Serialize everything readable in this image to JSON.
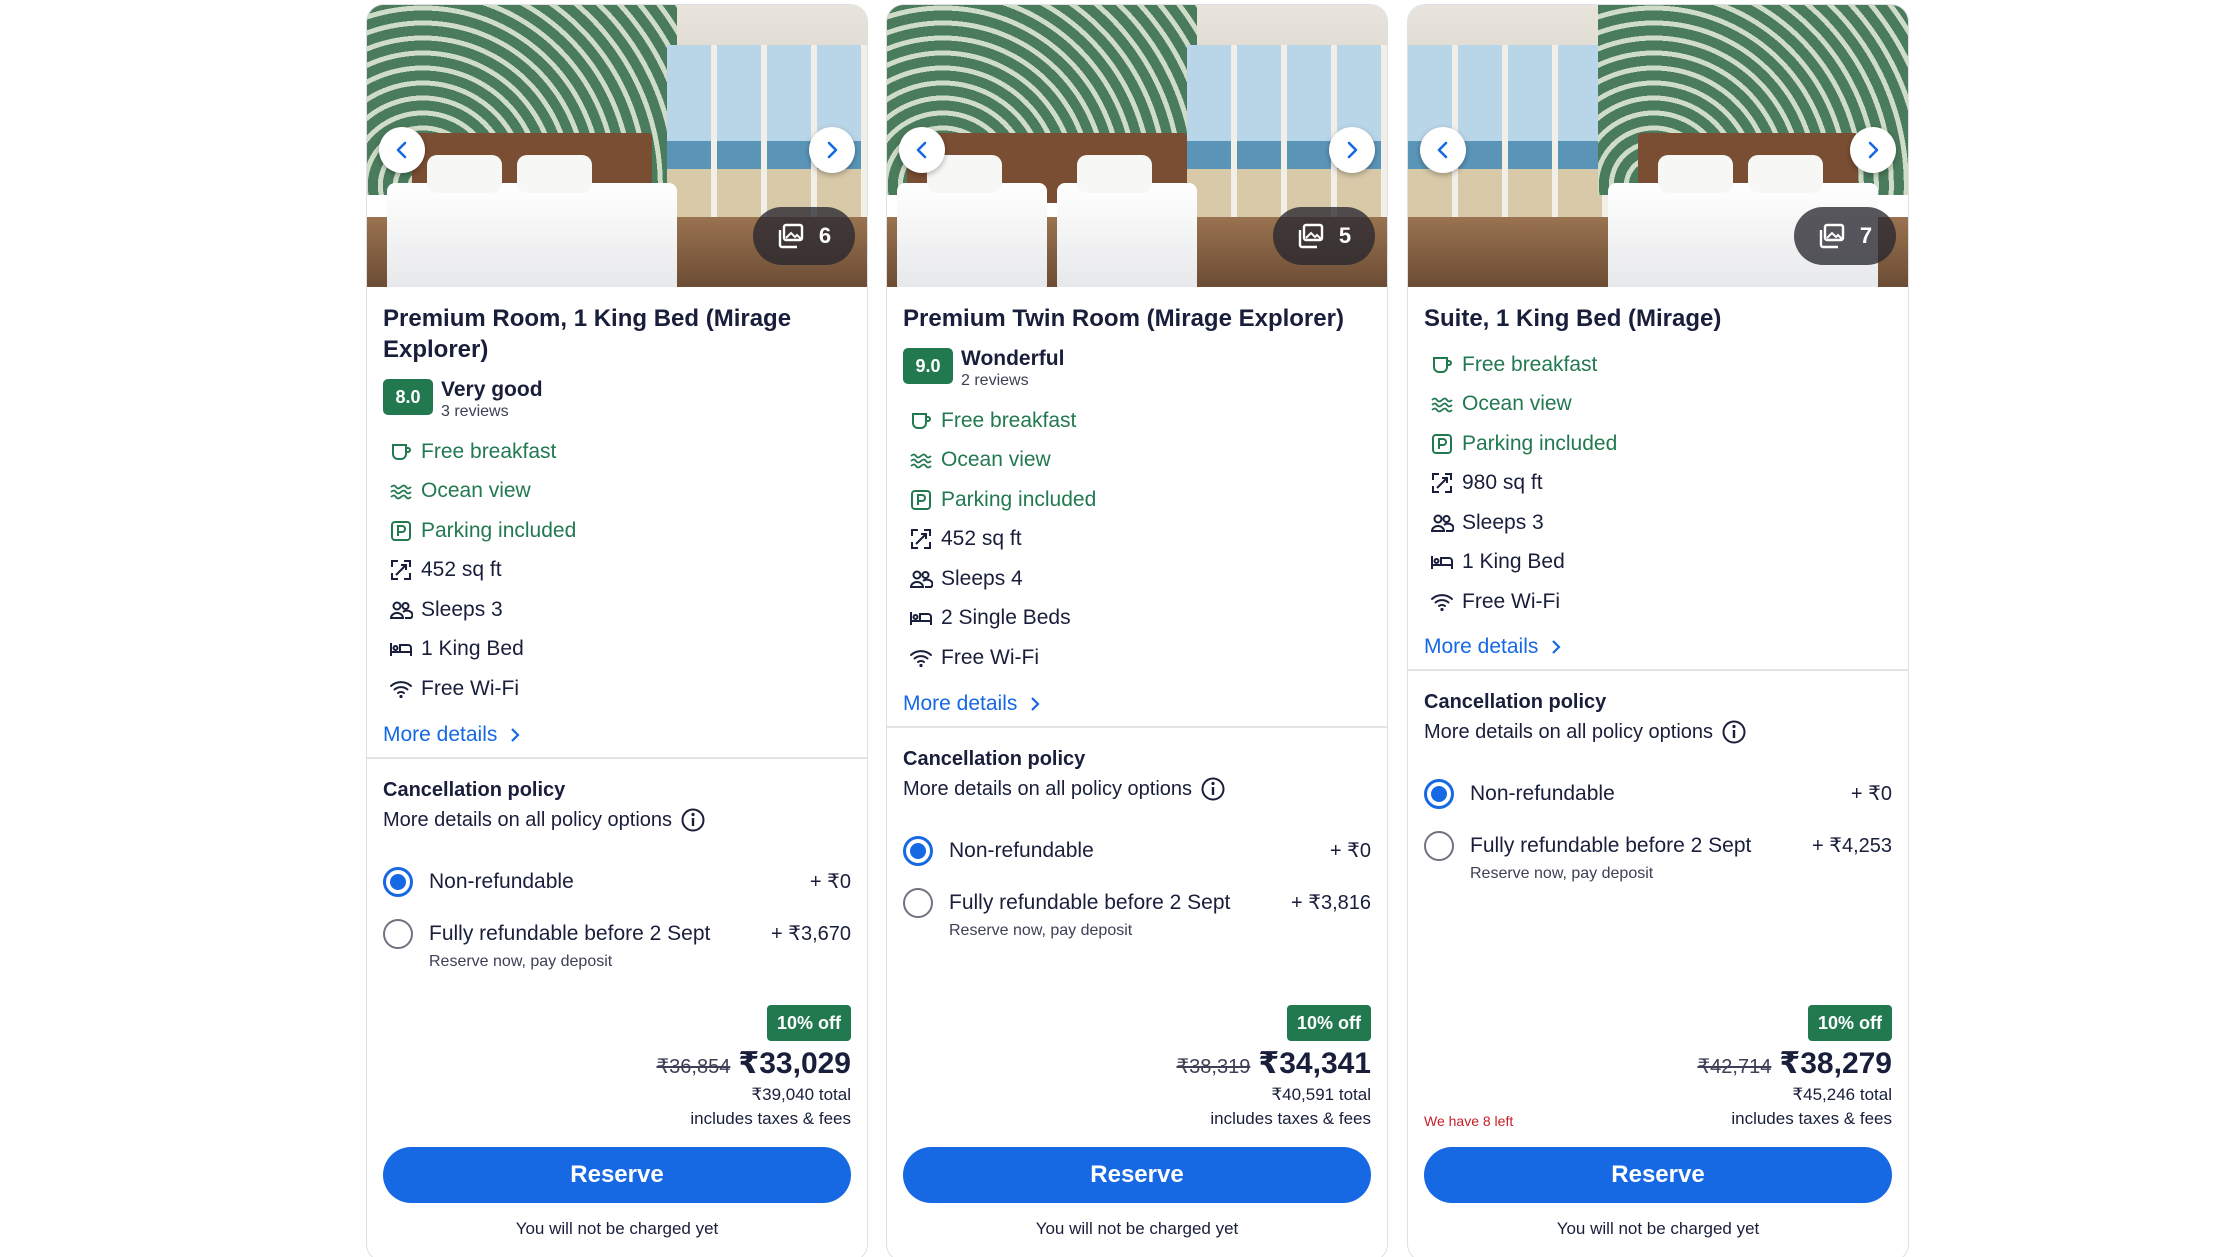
{
  "ui": {
    "reserve_label": "Reserve",
    "no_charge_note": "You will not be charged yet",
    "more_details": "More details",
    "policy_title": "Cancellation policy",
    "policy_more": "More details on all policy options",
    "includes_taxes": "includes taxes & fees",
    "icons": {
      "prev": "chevron-left-icon",
      "next": "chevron-right-icon",
      "gallery": "photo-gallery-icon",
      "info": "info-icon"
    },
    "colors": {
      "accent": "#1668e3",
      "green": "#227950",
      "text": "#191e3b",
      "alert": "#c41f27"
    }
  },
  "rooms": [
    {
      "image_count": "6",
      "title": "Premium Room, 1 King Bed (Mirage Explorer)",
      "rating": {
        "score": "8.0",
        "word": "Very good",
        "reviews": "3 reviews"
      },
      "amenities": [
        {
          "icon": "breakfast-icon",
          "text": "Free breakfast",
          "highlight": true
        },
        {
          "icon": "ocean-view-icon",
          "text": "Ocean view",
          "highlight": true
        },
        {
          "icon": "parking-icon",
          "text": "Parking included",
          "highlight": true
        },
        {
          "icon": "area-icon",
          "text": "452 sq ft",
          "highlight": false
        },
        {
          "icon": "people-icon",
          "text": "Sleeps 3",
          "highlight": false
        },
        {
          "icon": "bed-icon",
          "text": "1 King Bed",
          "highlight": false
        },
        {
          "icon": "wifi-icon",
          "text": "Free Wi-Fi",
          "highlight": false
        }
      ],
      "options": [
        {
          "label": "Non-refundable",
          "price": "+ ₹0",
          "sub": "",
          "checked": true
        },
        {
          "label": "Fully refundable before 2 Sept",
          "price": "+ ₹3,670",
          "sub": "Reserve now, pay deposit",
          "checked": false
        }
      ],
      "discount": "10% off",
      "old_price": "₹36,854",
      "price": "₹33,029",
      "total": "₹39,040 total",
      "left_note": ""
    },
    {
      "image_count": "5",
      "title": "Premium Twin Room (Mirage Explorer)",
      "rating": {
        "score": "9.0",
        "word": "Wonderful",
        "reviews": "2 reviews"
      },
      "amenities": [
        {
          "icon": "breakfast-icon",
          "text": "Free breakfast",
          "highlight": true
        },
        {
          "icon": "ocean-view-icon",
          "text": "Ocean view",
          "highlight": true
        },
        {
          "icon": "parking-icon",
          "text": "Parking included",
          "highlight": true
        },
        {
          "icon": "area-icon",
          "text": "452 sq ft",
          "highlight": false
        },
        {
          "icon": "people-icon",
          "text": "Sleeps 4",
          "highlight": false
        },
        {
          "icon": "bed-icon",
          "text": "2 Single Beds",
          "highlight": false
        },
        {
          "icon": "wifi-icon",
          "text": "Free Wi-Fi",
          "highlight": false
        }
      ],
      "options": [
        {
          "label": "Non-refundable",
          "price": "+ ₹0",
          "sub": "",
          "checked": true
        },
        {
          "label": "Fully refundable before 2 Sept",
          "price": "+ ₹3,816",
          "sub": "Reserve now, pay deposit",
          "checked": false
        }
      ],
      "discount": "10% off",
      "old_price": "₹38,319",
      "price": "₹34,341",
      "total": "₹40,591 total",
      "left_note": ""
    },
    {
      "image_count": "7",
      "title": "Suite, 1 King Bed (Mirage)",
      "rating": null,
      "amenities": [
        {
          "icon": "breakfast-icon",
          "text": "Free breakfast",
          "highlight": true
        },
        {
          "icon": "ocean-view-icon",
          "text": "Ocean view",
          "highlight": true
        },
        {
          "icon": "parking-icon",
          "text": "Parking included",
          "highlight": true
        },
        {
          "icon": "area-icon",
          "text": "980 sq ft",
          "highlight": false
        },
        {
          "icon": "people-icon",
          "text": "Sleeps 3",
          "highlight": false
        },
        {
          "icon": "bed-icon",
          "text": "1 King Bed",
          "highlight": false
        },
        {
          "icon": "wifi-icon",
          "text": "Free Wi-Fi",
          "highlight": false
        }
      ],
      "options": [
        {
          "label": "Non-refundable",
          "price": "+ ₹0",
          "sub": "",
          "checked": true
        },
        {
          "label": "Fully refundable before 2 Sept",
          "price": "+ ₹4,253",
          "sub": "Reserve now, pay deposit",
          "checked": false
        }
      ],
      "discount": "10% off",
      "old_price": "₹42,714",
      "price": "₹38,279",
      "total": "₹45,246 total",
      "left_note": "We have 8 left"
    }
  ]
}
